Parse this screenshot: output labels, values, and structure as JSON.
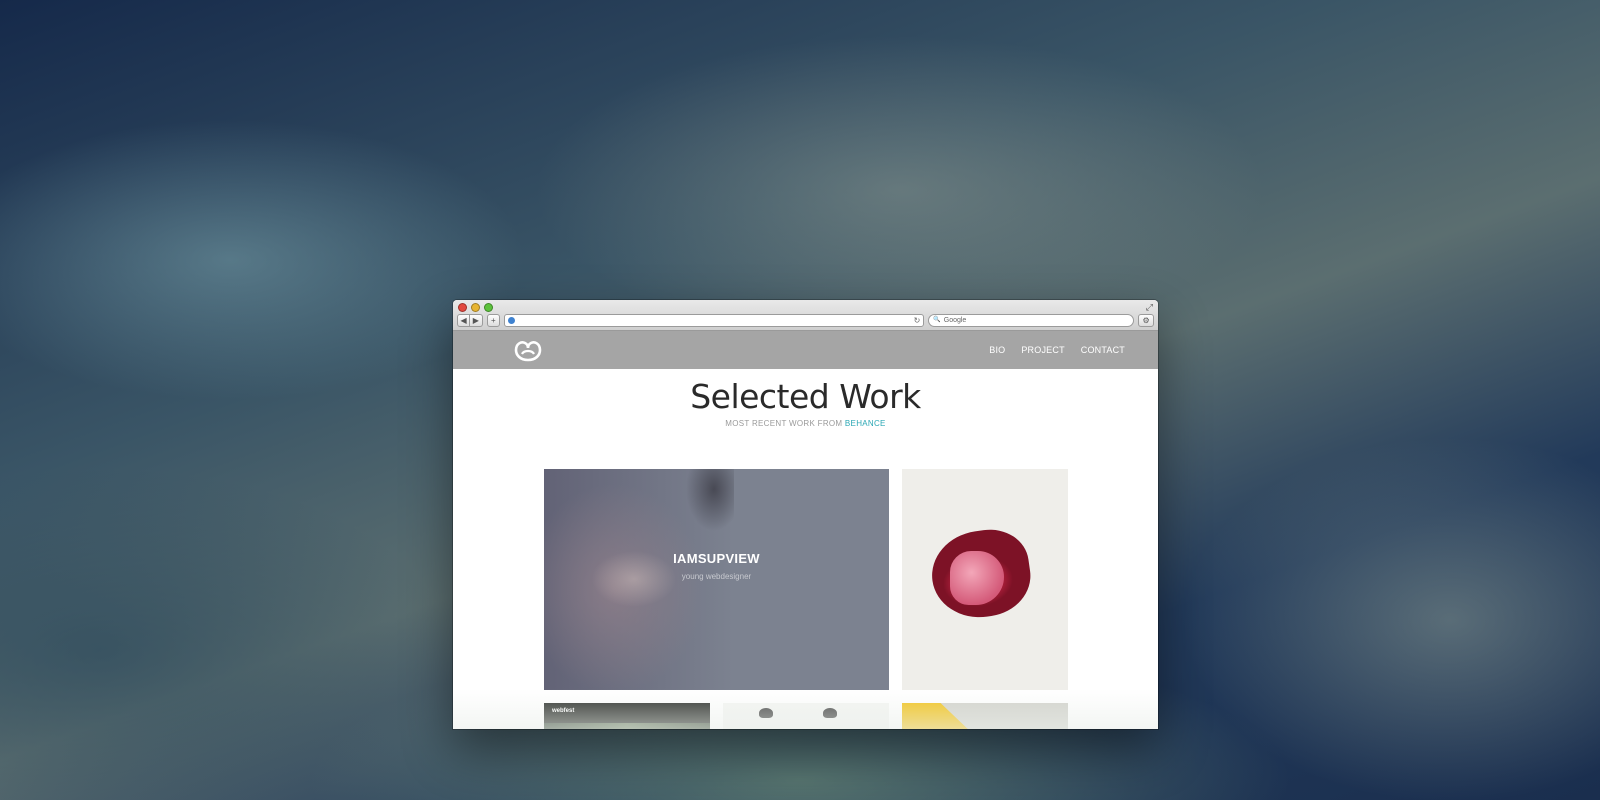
{
  "browser": {
    "search_placeholder": "Google",
    "back_glyph": "◀",
    "forward_glyph": "▶",
    "add_glyph": "+",
    "reload_glyph": "↻",
    "fullscreen_glyph": "⤢",
    "gear_glyph": "⚙",
    "search_glyph": "🔍",
    "colors": {
      "close": "#e2483f",
      "minimize": "#e7b431",
      "zoom": "#5cc23c"
    }
  },
  "site": {
    "nav": [
      "BIO",
      "PROJECT",
      "CONTACT"
    ],
    "title": "Selected Work",
    "subtitle_prefix": "MOST RECENT WORK FROM ",
    "subtitle_link": "BEHANCE",
    "accent_color": "#2aa7b4",
    "nav_bg": "#a5a5a5"
  },
  "featured": {
    "title": "IAMSUPVIEW",
    "subtitle": "young webdesigner"
  },
  "thumbs": {
    "webfest_label": "webfest"
  }
}
